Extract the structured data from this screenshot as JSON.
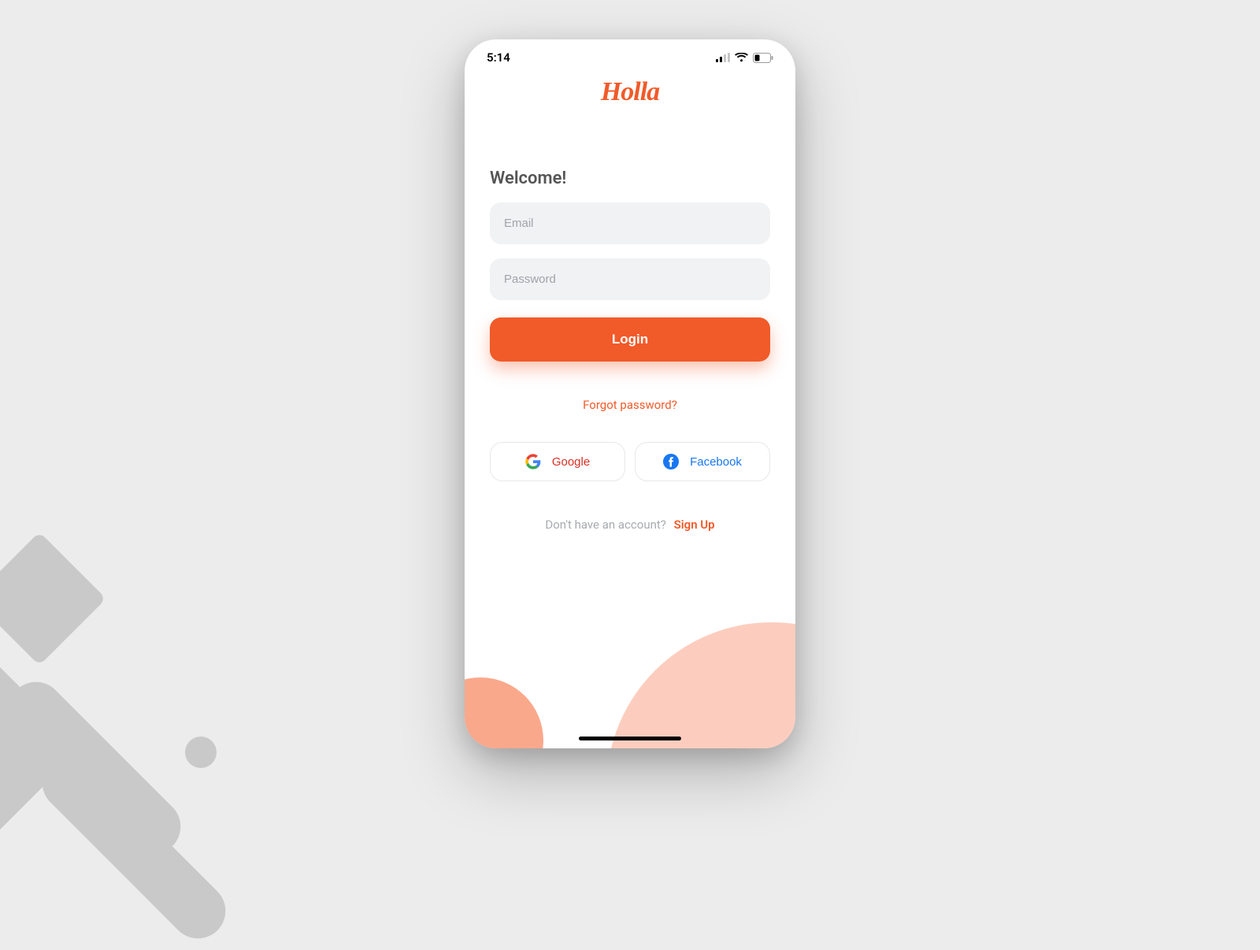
{
  "status_bar": {
    "time": "5:14",
    "signal_icon": "signal-icon",
    "wifi_icon": "wifi-icon",
    "battery_icon": "battery-icon"
  },
  "app": {
    "logo_text": "Holla"
  },
  "login": {
    "heading": "Welcome!",
    "email_placeholder": "Email",
    "email_value": "",
    "password_placeholder": "Password",
    "password_value": "",
    "login_label": "Login",
    "forgot_label": "Forgot password?",
    "social": {
      "google_label": "Google",
      "facebook_label": "Facebook"
    },
    "signup_prompt": "Don't have an account?",
    "signup_link": "Sign Up"
  },
  "colors": {
    "accent": "#f15a29",
    "peach_light": "#fccdbe",
    "peach_dark": "#faa88c",
    "input_bg": "#f1f2f4"
  }
}
